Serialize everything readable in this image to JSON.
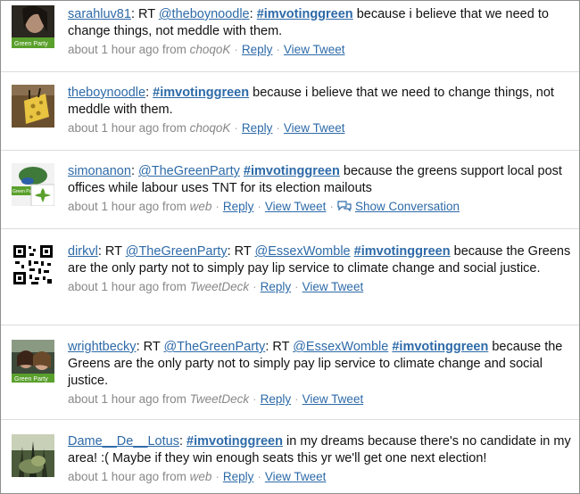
{
  "tweets": [
    {
      "user": "sarahluv81",
      "parts": [
        {
          "t": "text",
          "v": ": RT "
        },
        {
          "t": "mention",
          "v": "@theboynoodle"
        },
        {
          "t": "text",
          "v": ": "
        },
        {
          "t": "hashtag",
          "v": "#imvotinggreen"
        },
        {
          "t": "text",
          "v": " because i believe that we need to change things, not meddle with them."
        }
      ],
      "time": "about 1 hour ago from",
      "source": "choqoK",
      "links": [
        "Reply",
        "View Tweet"
      ],
      "avatar_badge": "Green Party"
    },
    {
      "user": "theboynoodle",
      "parts": [
        {
          "t": "text",
          "v": ": "
        },
        {
          "t": "hashtag",
          "v": "#imvotinggreen"
        },
        {
          "t": "text",
          "v": " because i believe that we need to change things, not meddle with them."
        }
      ],
      "time": "about 1 hour ago from",
      "source": "choqoK",
      "links": [
        "Reply",
        "View Tweet"
      ],
      "avatar_badge": ""
    },
    {
      "user": "simonanon",
      "parts": [
        {
          "t": "text",
          "v": ": "
        },
        {
          "t": "mention",
          "v": "@TheGreenParty"
        },
        {
          "t": "text",
          "v": " "
        },
        {
          "t": "hashtag",
          "v": "#imvotinggreen"
        },
        {
          "t": "text",
          "v": " because the greens support local post offices while labour uses TNT for its election mailouts"
        }
      ],
      "time": "about 1 hour ago from",
      "source": "web",
      "links": [
        "Reply",
        "View Tweet",
        "Show Conversation"
      ],
      "avatar_badge": "Green Party"
    },
    {
      "user": "dirkvl",
      "parts": [
        {
          "t": "text",
          "v": ": RT "
        },
        {
          "t": "mention",
          "v": "@TheGreenParty"
        },
        {
          "t": "text",
          "v": ": RT "
        },
        {
          "t": "mention",
          "v": "@EssexWomble"
        },
        {
          "t": "text",
          "v": " "
        },
        {
          "t": "hashtag",
          "v": "#imvotinggreen"
        },
        {
          "t": "text",
          "v": " because the Greens are the only party not to simply pay lip service to climate change and social justice."
        }
      ],
      "time": "about 1 hour ago from",
      "source": "TweetDeck",
      "links": [
        "Reply",
        "View Tweet"
      ],
      "avatar_badge": ""
    },
    {
      "user": "wrightbecky",
      "parts": [
        {
          "t": "text",
          "v": ": RT "
        },
        {
          "t": "mention",
          "v": "@TheGreenParty"
        },
        {
          "t": "text",
          "v": ": RT "
        },
        {
          "t": "mention",
          "v": "@EssexWomble"
        },
        {
          "t": "text",
          "v": " "
        },
        {
          "t": "hashtag",
          "v": "#imvotinggreen"
        },
        {
          "t": "text",
          "v": " because the Greens are the only party not to simply pay lip service to climate change and social justice."
        }
      ],
      "time": "about 1 hour ago from",
      "source": "TweetDeck",
      "links": [
        "Reply",
        "View Tweet"
      ],
      "avatar_badge": "Green Party"
    },
    {
      "user": "Dame__De__Lotus",
      "parts": [
        {
          "t": "text",
          "v": ": "
        },
        {
          "t": "hashtag",
          "v": "#imvotinggreen"
        },
        {
          "t": "text",
          "v": " in my dreams because there's no candidate in my area! :( Maybe if they win enough seats this yr we'll get one next election!"
        }
      ],
      "time": "about 1 hour ago from",
      "source": "web",
      "links": [
        "Reply",
        "View Tweet"
      ],
      "avatar_badge": ""
    }
  ],
  "icons": {
    "conversation": "speech-bubble-icon"
  },
  "colors": {
    "link": "#2d6aa8",
    "meta": "#888888",
    "divider": "#dcdcdc",
    "badge": "#5aa02c"
  }
}
